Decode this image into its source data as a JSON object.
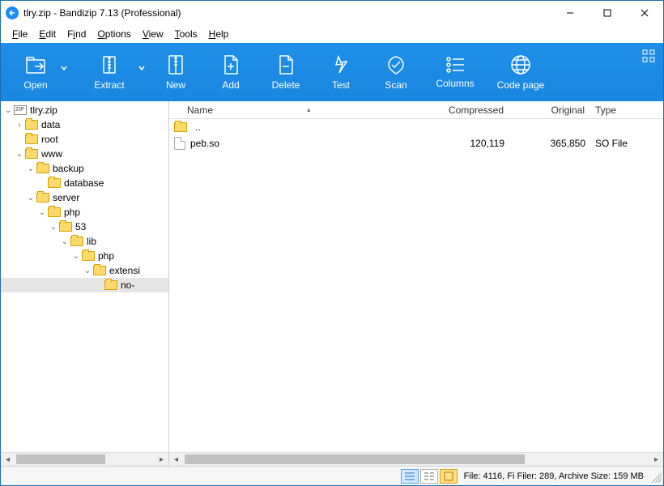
{
  "window": {
    "title": "tlry.zip - Bandizip 7.13 (Professional)"
  },
  "menu": {
    "file": "File",
    "edit": "Edit",
    "find": "Find",
    "options": "Options",
    "view": "View",
    "tools": "Tools",
    "help": "Help"
  },
  "toolbar": {
    "open": "Open",
    "extract": "Extract",
    "new": "New",
    "add": "Add",
    "delete": "Delete",
    "test": "Test",
    "scan": "Scan",
    "columns": "Columns",
    "codepage": "Code page"
  },
  "tree": {
    "root": "tlry.zip",
    "n0": "data",
    "n1": "root",
    "n2": "www",
    "n3": "backup",
    "n4": "database",
    "n5": "server",
    "n6": "php",
    "n7": "53",
    "n8": "lib",
    "n9": "php",
    "n10": "extensi",
    "n11": "no-"
  },
  "list": {
    "headers": {
      "name": "Name",
      "compressed": "Compressed",
      "original": "Original",
      "type": "Type"
    },
    "rows": [
      {
        "name": "..",
        "compressed": "",
        "original": "",
        "type": "",
        "icon": "folder"
      },
      {
        "name": "peb.so",
        "compressed": "120,119",
        "original": "365,850",
        "type": "SO File",
        "icon": "file"
      }
    ]
  },
  "status": {
    "text": "File: 4116, Fi Filer: 289, Archive Size: 159 MB"
  }
}
